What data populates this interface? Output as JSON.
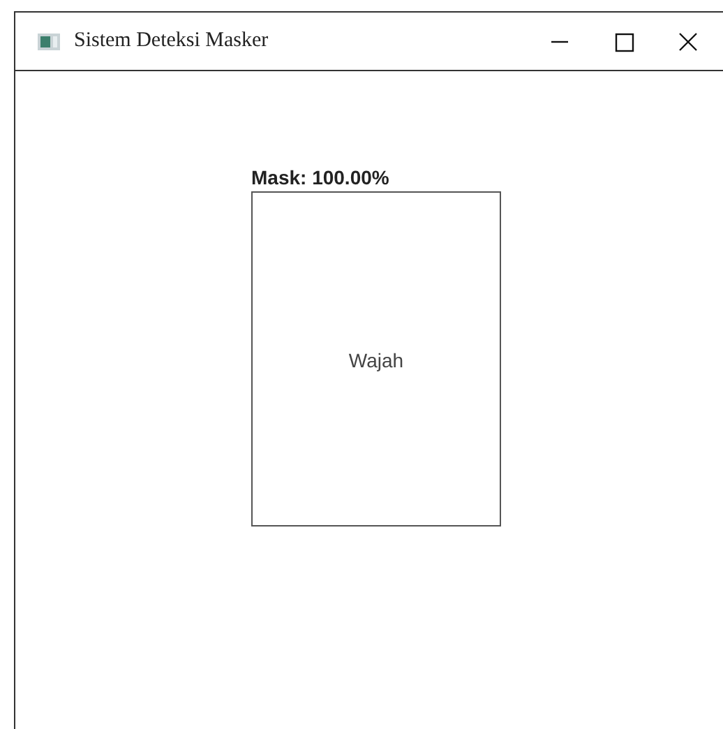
{
  "window": {
    "title": "Sistem Deteksi Masker"
  },
  "detection": {
    "label": "Mask: 100.00%",
    "face_text": "Wajah"
  }
}
